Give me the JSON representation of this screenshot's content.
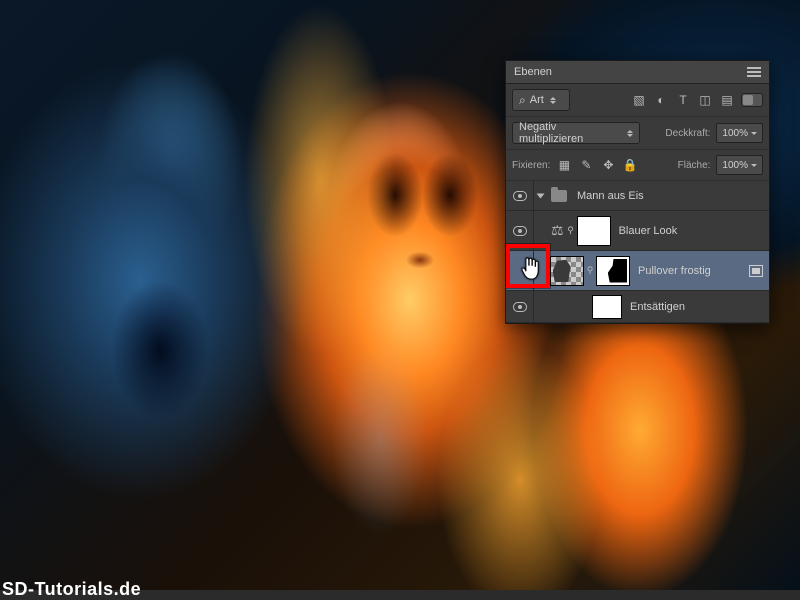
{
  "panel": {
    "title": "Ebenen",
    "filter": {
      "kind_label": "Art"
    },
    "blend_mode": "Negativ multiplizieren",
    "opacity_label": "Deckkraft:",
    "opacity_value": "100%",
    "lock_label": "Fixieren:",
    "fill_label": "Fläche:",
    "fill_value": "100%"
  },
  "layers": {
    "group": {
      "name": "Mann aus Eis"
    },
    "items": [
      {
        "name": "Blauer Look"
      },
      {
        "name": "Pullover frostig"
      },
      {
        "name": "Entsättigen"
      }
    ]
  },
  "watermark": "SD-Tutorials.de"
}
